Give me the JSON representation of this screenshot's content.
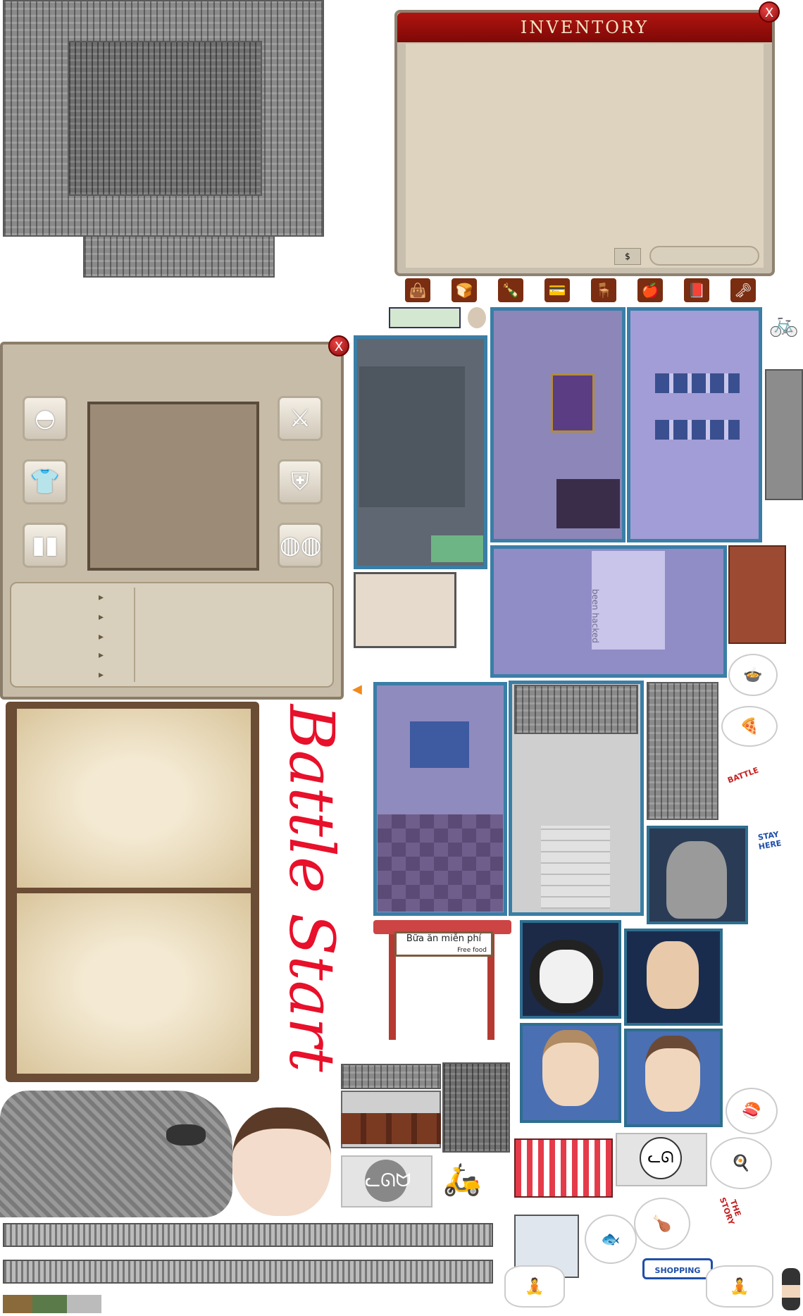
{
  "inventory": {
    "title": "INVENTORY",
    "close_label": "X",
    "currency_icon": "money-icon",
    "slots": [
      {
        "icon": "bag-icon",
        "glyph": "👜"
      },
      {
        "icon": "bread-icon",
        "glyph": "🍞"
      },
      {
        "icon": "bottle-icon",
        "glyph": "🍾"
      },
      {
        "icon": "card-icon",
        "glyph": "💳"
      },
      {
        "icon": "chair-icon",
        "glyph": "🪑"
      },
      {
        "icon": "apple-icon",
        "glyph": "🍎"
      },
      {
        "icon": "book-icon",
        "glyph": "📕"
      },
      {
        "icon": "key-icon",
        "glyph": "🗝"
      }
    ]
  },
  "equipment": {
    "close_label": "X",
    "left_slots": [
      "cap-icon",
      "shirt-icon",
      "pants-icon"
    ],
    "right_slots": [
      "weapon-icon",
      "armor-icon",
      "sandals-icon"
    ],
    "stat_arrows": [
      "▸",
      "▸",
      "▸",
      "▸",
      "▸"
    ]
  },
  "map_texts": {
    "hacked_label": "been hacked"
  },
  "battle_text": "Battle Start",
  "sign": {
    "line1": "Bữa ăn miễn phí",
    "line2": "Free food"
  },
  "stickers": {
    "shopping": "SHOPPING",
    "stay_here": "STAY HERE",
    "the_story": "THE STORY",
    "battle": "BATTLE"
  },
  "colors": {
    "accent_red": "#a5120d",
    "map_border": "#3a7ea6",
    "battle_text": "#e8102a",
    "panel_bg": "#c7bca8"
  }
}
